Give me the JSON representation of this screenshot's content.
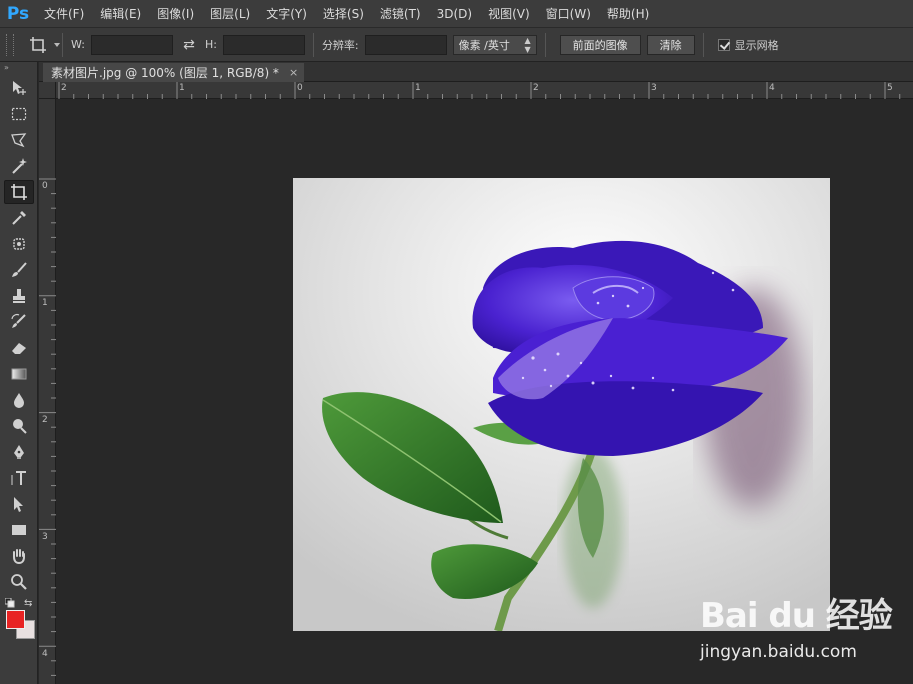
{
  "app": {
    "logo": "Ps"
  },
  "menu": [
    "文件(F)",
    "编辑(E)",
    "图像(I)",
    "图层(L)",
    "文字(Y)",
    "选择(S)",
    "滤镜(T)",
    "3D(D)",
    "视图(V)",
    "窗口(W)",
    "帮助(H)"
  ],
  "options": {
    "tool_preset_icon": "crop-icon",
    "width_label": "W:",
    "width_value": "",
    "height_label": "H:",
    "height_value": "",
    "resolution_label": "分辨率:",
    "resolution_value": "",
    "unit_select": "像素 /英寸",
    "front_image_button": "前面的图像",
    "clear_button": "清除",
    "show_grid_label": "显示网格",
    "show_grid_checked": true
  },
  "document": {
    "tab_title": "素材图片.jpg @ 100% (图层 1, RGB/8) *",
    "close_glyph": "×"
  },
  "ruler": {
    "top_labels": [
      "2",
      "1",
      "0",
      "1",
      "2",
      "3",
      "4",
      "5"
    ],
    "left_labels": [
      "0",
      "1",
      "2",
      "3",
      "4"
    ]
  },
  "colors": {
    "foreground": "#e82323",
    "background": "#e8e0e0",
    "accent": "#31a8ff"
  },
  "tools": [
    "move-icon",
    "marquee-icon",
    "lasso-icon",
    "magic-wand-icon",
    "crop-icon",
    "eyedropper-icon",
    "spot-healing-icon",
    "brush-icon",
    "clone-stamp-icon",
    "history-brush-icon",
    "eraser-icon",
    "gradient-icon",
    "blur-icon",
    "dodge-icon",
    "pen-icon",
    "type-icon",
    "path-selection-icon",
    "rectangle-icon",
    "hand-icon",
    "zoom-icon"
  ],
  "watermark": {
    "brand": "Bai du 经验",
    "url": "jingyan.baidu.com"
  }
}
